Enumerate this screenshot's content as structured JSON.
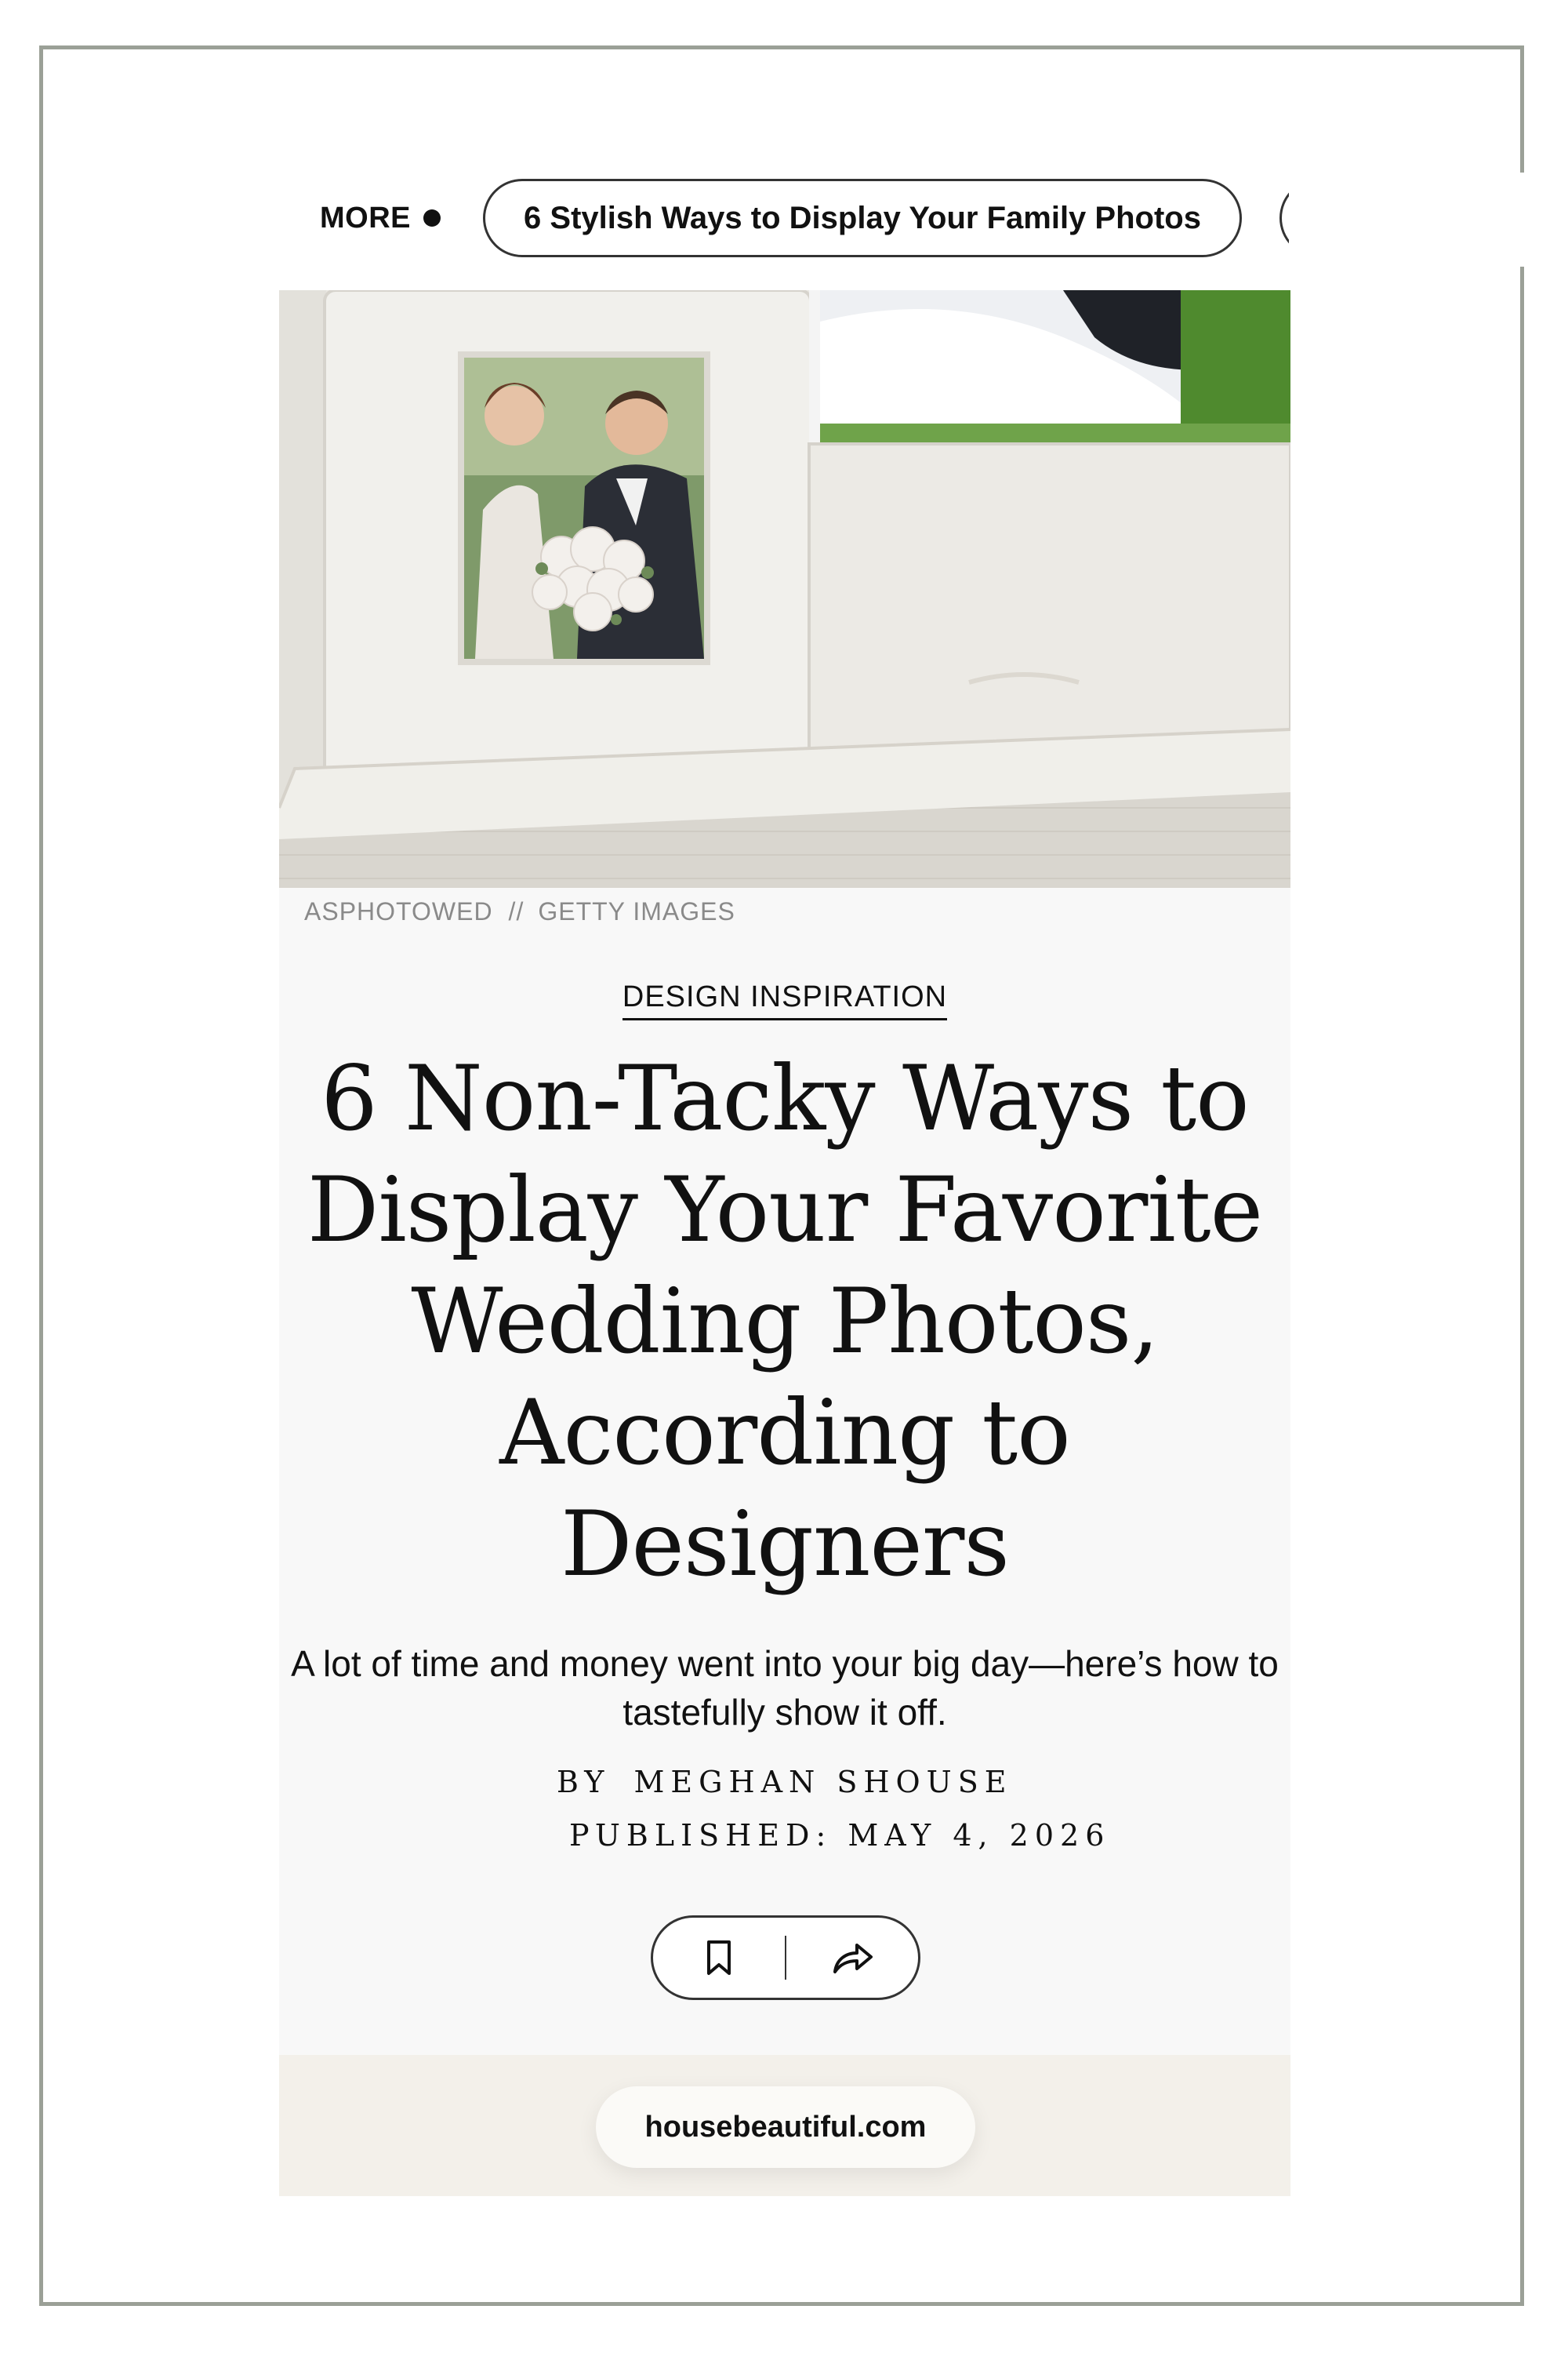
{
  "more_nav": {
    "label": "MORE",
    "chips": [
      "6 Stylish Ways to Display Your Family Photos",
      ""
    ]
  },
  "hero": {
    "credit_photographer": "ASPHOTOWED",
    "credit_separator": "//",
    "credit_agency": "GETTY IMAGES"
  },
  "article": {
    "category": "DESIGN INSPIRATION",
    "headline": "6 Non-Tacky Ways to Display Your Favorite Wedding Photos, According to Designers",
    "dek": "A lot of time and money went into your big day—here’s how to tastefully show it off.",
    "byline_prefix": "BY",
    "author": "MEGHAN SHOUSE",
    "published": "PUBLISHED: MAY 4, 2026"
  },
  "actions": {
    "bookmark_icon": "bookmark-icon",
    "share_icon": "share-icon"
  },
  "footer": {
    "domain": "housebeautiful.com"
  }
}
